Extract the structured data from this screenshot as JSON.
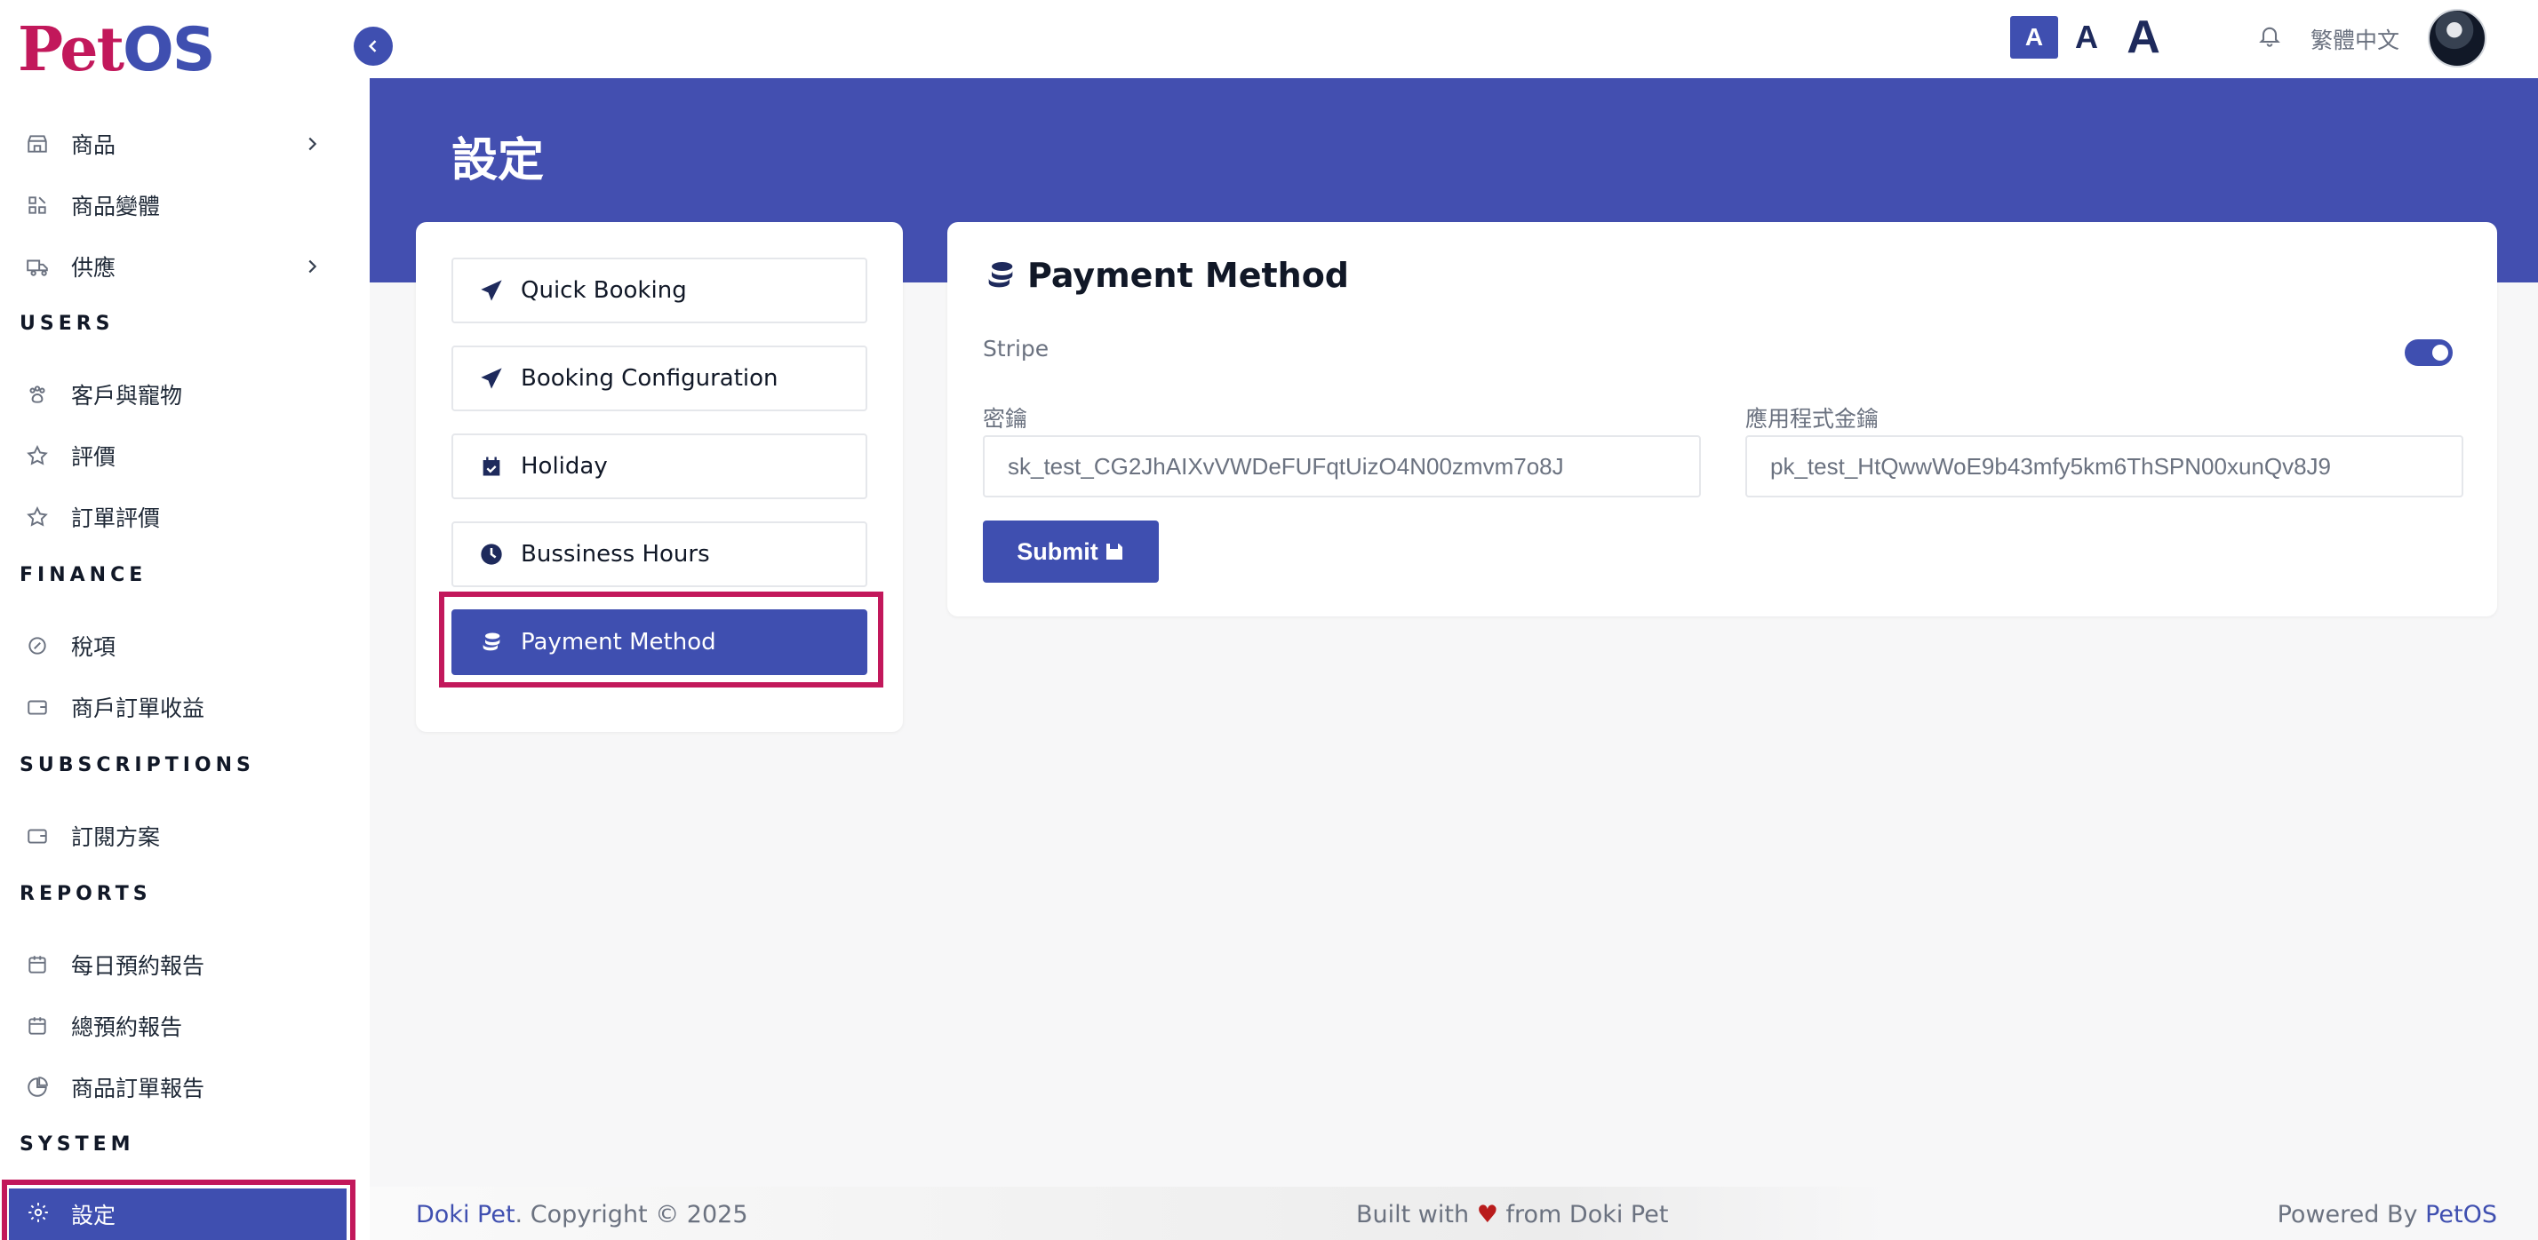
{
  "app": {
    "logo_pet": "Pet",
    "logo_os": "OS"
  },
  "topbar": {
    "font_small": "A",
    "font_medium": "A",
    "font_large": "A",
    "language": "繁體中文"
  },
  "sidebar": {
    "items": [
      {
        "label": "商品",
        "icon": "store-icon"
      },
      {
        "label": "商品變體",
        "icon": "variants-icon"
      },
      {
        "label": "供應",
        "icon": "truck-icon"
      },
      {
        "label": "客戶與寵物",
        "icon": "paw-icon"
      },
      {
        "label": "評價",
        "icon": "star-icon"
      },
      {
        "label": "訂單評價",
        "icon": "star-icon"
      },
      {
        "label": "稅項",
        "icon": "tax-icon"
      },
      {
        "label": "商戶訂單收益",
        "icon": "wallet-icon"
      },
      {
        "label": "訂閱方案",
        "icon": "wallet-icon"
      },
      {
        "label": "每日預約報告",
        "icon": "calendar-icon"
      },
      {
        "label": "總預約報告",
        "icon": "calendar-icon"
      },
      {
        "label": "商品訂單報告",
        "icon": "pie-chart-icon"
      },
      {
        "label": "設定",
        "icon": "gear-icon"
      }
    ],
    "sections": {
      "users": "USERS",
      "finance": "FINANCE",
      "subscriptions": "SUBSCRIPTIONS",
      "reports": "REPORTS",
      "system": "SYSTEM"
    }
  },
  "page": {
    "title": "設定"
  },
  "settings_menu": [
    {
      "label": "Quick Booking",
      "icon": "paper-plane-icon"
    },
    {
      "label": "Booking Configuration",
      "icon": "paper-plane-icon"
    },
    {
      "label": "Holiday",
      "icon": "calendar-check-icon"
    },
    {
      "label": "Bussiness Hours",
      "icon": "clock-icon"
    },
    {
      "label": "Payment Method",
      "icon": "coins-icon",
      "active": true
    }
  ],
  "payment": {
    "title": "Payment Method",
    "stripe_label": "Stripe",
    "stripe_enabled": true,
    "secret_label": "密鑰",
    "secret_value": "sk_test_CG2JhAIXvVWDeFUFqtUizO4N00zmvm7o8J",
    "app_key_label": "應用程式金鑰",
    "app_key_value": "pk_test_HtQwwWoE9b43mfy5km6ThSPN00xunQv8J9",
    "submit_label": "Submit"
  },
  "footer": {
    "brand": "Doki Pet",
    "copyright": ". Copyright © 2025",
    "built_prefix": "Built with ",
    "heart": "♥",
    "built_suffix": " from Doki Pet",
    "powered_prefix": "Powered By ",
    "powered_brand": "PetOS"
  },
  "colors": {
    "primary": "#3f4fb0",
    "highlight": "#c2185b",
    "banner": "#434fb0"
  }
}
